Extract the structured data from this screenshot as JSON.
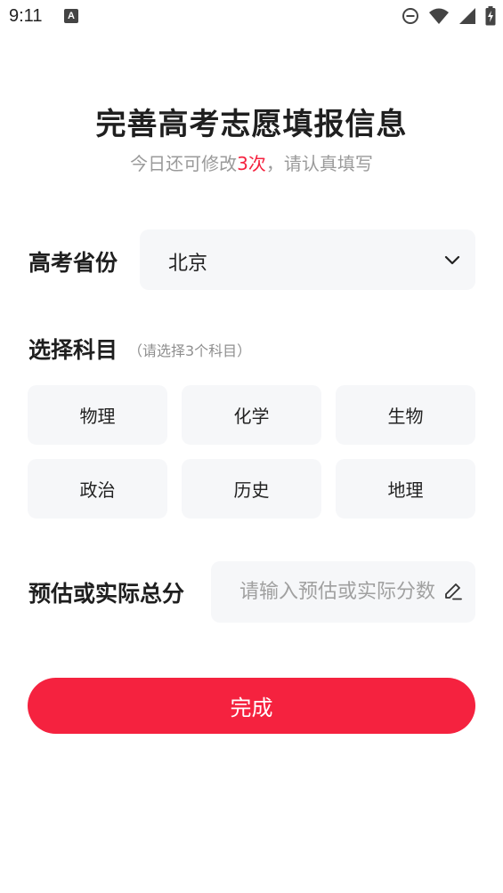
{
  "status_bar": {
    "time": "9:11",
    "notification_icon": "A",
    "icons": [
      "dnd-icon",
      "wifi-icon",
      "signal-icon",
      "battery-icon"
    ]
  },
  "header": {
    "title": "完善高考志愿填报信息",
    "subtitle_prefix": "今日还可修改",
    "subtitle_count": "3次",
    "subtitle_suffix": "，请认真填写"
  },
  "province": {
    "label": "高考省份",
    "selected": "北京"
  },
  "subjects": {
    "label": "选择科目",
    "hint": "（请选择3个科目）",
    "options": [
      "物理",
      "化学",
      "生物",
      "政治",
      "历史",
      "地理"
    ]
  },
  "score": {
    "label": "预估或实际总分",
    "value": "",
    "placeholder": "请输入预估或实际分数"
  },
  "actions": {
    "done_label": "完成"
  },
  "colors": {
    "accent": "#f5223f",
    "field_bg": "#f6f7f9",
    "muted_text": "#9a9a9a"
  }
}
